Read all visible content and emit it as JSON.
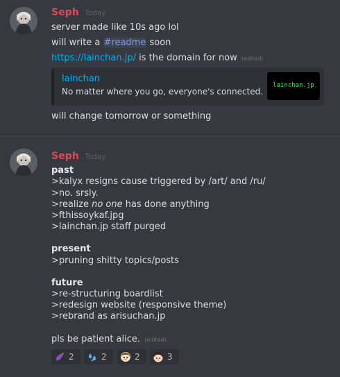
{
  "colors": {
    "background": "#36393f",
    "username": "#e0485a",
    "link": "#00b0f4",
    "mention": "#7e9bde",
    "embed_bg": "#2f3136"
  },
  "messages": [
    {
      "author": "Seph",
      "timestamp": "Today",
      "avatar_icon": "user-avatar",
      "lines": {
        "l1": "server made like 10s ago lol",
        "l2_prefix": "will write a ",
        "l2_mention": "#readme",
        "l2_suffix": " soon",
        "l3_link": "https://lainchan.jp/",
        "l3_suffix": " is the domain for now",
        "l3_edited": "(edited)",
        "l4": "will change tomorrow or something"
      },
      "embed": {
        "title": "lainchan",
        "description": "No matter where you go, everyone's connected.",
        "thumbnail_text": "lainchan.jp"
      }
    },
    {
      "author": "Seph",
      "timestamp": "Today",
      "avatar_icon": "user-avatar",
      "lines": {
        "past_heading": "past",
        "p1": ">kalyx resigns cause triggered by /art/ and /ru/",
        "p2": ">no. srsly.",
        "p3_prefix": ">realize ",
        "p3_italic": "no one",
        "p3_suffix": " has done anything",
        "p4": ">fthissoykaf.jpg",
        "p5": ">lainchan.jp staff purged",
        "present_heading": "present",
        "pr1": ">pruning shitty topics/posts",
        "future_heading": "future",
        "f1": ">re-structuring boardlist",
        "f2": ">redesign website (responsive theme)",
        "f3": ">rebrand as arisuchan.jp",
        "closing": "pls be patient alice.",
        "closing_edited": "(edited)"
      },
      "reactions": [
        {
          "icon": "eggplant-icon",
          "count": "2"
        },
        {
          "icon": "sweat-drops-icon",
          "count": "2"
        },
        {
          "icon": "anime-face-icon",
          "count": "2"
        },
        {
          "icon": "anime-girl-icon",
          "count": "3"
        }
      ]
    }
  ]
}
